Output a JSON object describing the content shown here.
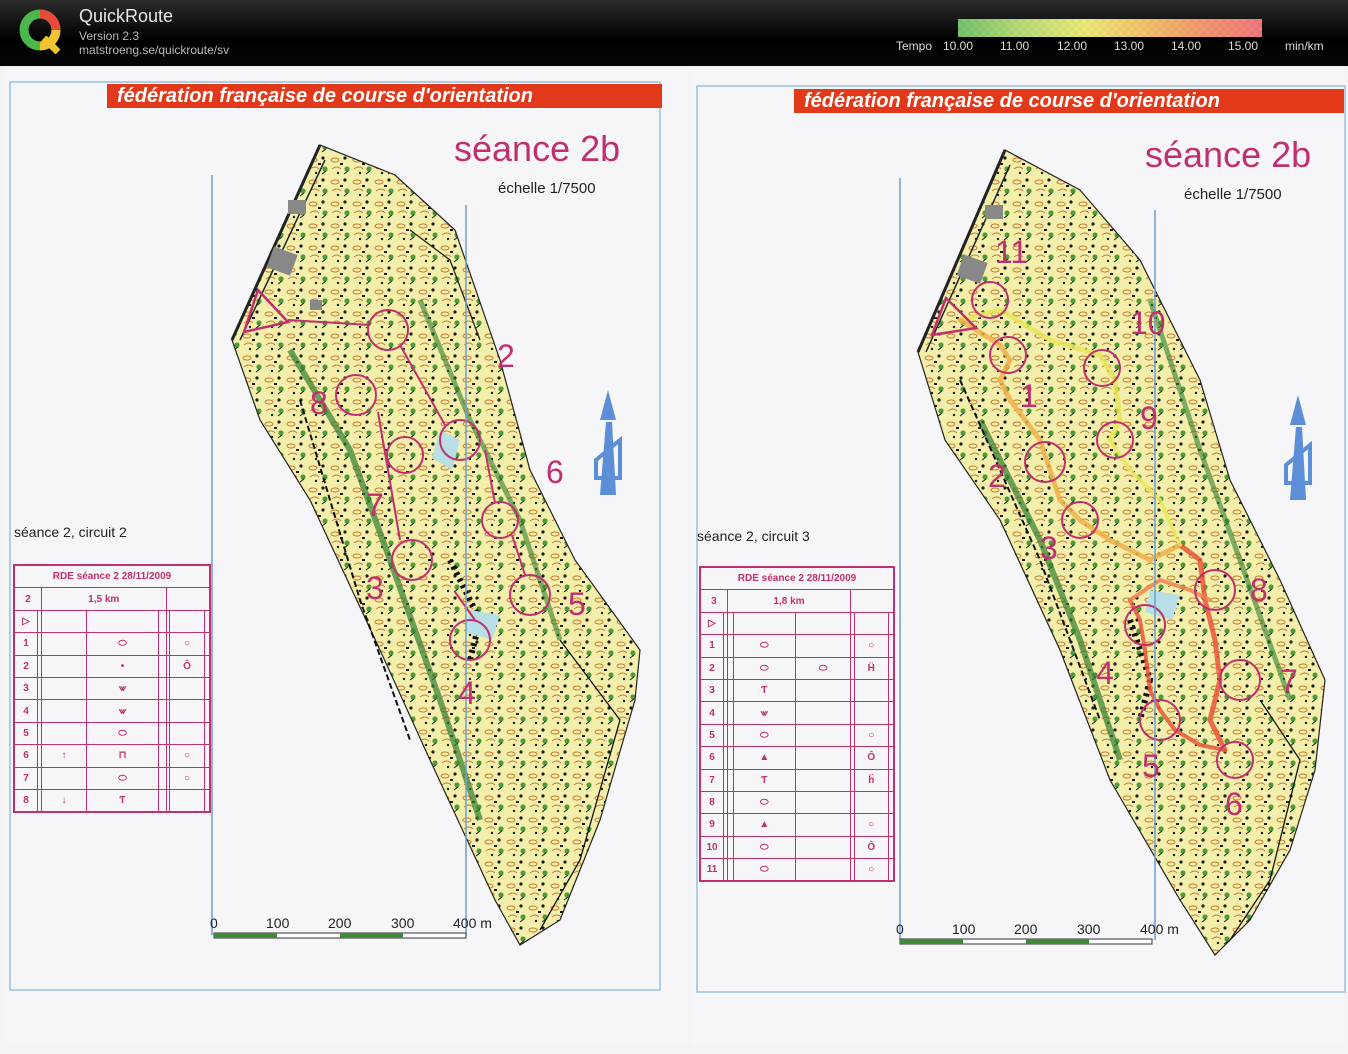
{
  "app": {
    "name": "QuickRoute",
    "version": "Version 2.3",
    "url": "matstroeng.se/quickroute/sv"
  },
  "tempo": {
    "label": "Tempo",
    "ticks": [
      "10.00",
      "11.00",
      "12.00",
      "13.00",
      "14.00",
      "15.00"
    ],
    "unit": "min/km",
    "colors": [
      "#55b54a",
      "#a8d35a",
      "#e9e65a",
      "#f2b44a",
      "#f0834e",
      "#ee5a60"
    ]
  },
  "colors": {
    "banner": "#e2391b",
    "course": "#c0306e",
    "map_bg": "#f3efaa",
    "route_fast": "#e8e45a",
    "route_slow": "#e8553a"
  },
  "left": {
    "banner": "fédération française de course d'orientation",
    "title": "séance 2b",
    "scale": "échelle 1/7500",
    "circuit": "séance 2, circuit 2",
    "table": {
      "header": "RDE séance 2 28/11/2009",
      "course": "2",
      "length": "1,5 km",
      "rows": [
        [
          "▷",
          "",
          "",
          "",
          "",
          "",
          "",
          ""
        ],
        [
          "1",
          "",
          "",
          "⬭",
          "",
          "",
          "○",
          ""
        ],
        [
          "2",
          "",
          "",
          "•",
          "",
          "",
          "Ô",
          ""
        ],
        [
          "3",
          "",
          "",
          "⩖",
          "",
          "",
          "",
          ""
        ],
        [
          "4",
          "",
          "",
          "⩖",
          "",
          "",
          "",
          ""
        ],
        [
          "5",
          "",
          "",
          "⬭",
          "",
          "",
          "",
          ""
        ],
        [
          "6",
          "",
          "↑",
          "⊓",
          "",
          "",
          "○",
          ""
        ],
        [
          "7",
          "",
          "",
          "⬭",
          "",
          "",
          "○",
          ""
        ],
        [
          "8",
          "",
          "↓",
          "Ƭ",
          "",
          "",
          "",
          ""
        ]
      ]
    },
    "controls": [
      "2",
      "8",
      "6",
      "7",
      "3",
      "5",
      "4"
    ],
    "scale_labels": [
      "0",
      "100",
      "200",
      "300",
      "400 m"
    ]
  },
  "right": {
    "banner": "fédération française de course d'orientation",
    "title": "séance 2b",
    "scale": "échelle 1/7500",
    "circuit": "séance 2, circuit 3",
    "table": {
      "header": "RDE séance 2 28/11/2009",
      "course": "3",
      "length": "1,8 km",
      "rows": [
        [
          "▷",
          "",
          "",
          "",
          "",
          "",
          "",
          ""
        ],
        [
          "1",
          "",
          "",
          "⬭",
          "",
          "",
          "○",
          ""
        ],
        [
          "2",
          "",
          "",
          "⬭",
          "⬭",
          "",
          "Ḧ",
          ""
        ],
        [
          "3",
          "",
          "",
          "Ƭ",
          "",
          "",
          "",
          ""
        ],
        [
          "4",
          "",
          "",
          "⩖",
          "",
          "",
          "",
          ""
        ],
        [
          "5",
          "",
          "",
          "⬭",
          "",
          "",
          "○",
          ""
        ],
        [
          "6",
          "",
          "",
          "▲",
          "",
          "",
          "Ô",
          ""
        ],
        [
          "7",
          "",
          "",
          "Ƭ",
          "",
          "",
          "ḧ",
          ""
        ],
        [
          "8",
          "",
          "",
          "⬭",
          "",
          "",
          "",
          ""
        ],
        [
          "9",
          "",
          "",
          "▲",
          "",
          "",
          "○",
          ""
        ],
        [
          "10",
          "",
          "",
          "⬭",
          "",
          "",
          "Ô",
          ""
        ],
        [
          "11",
          "",
          "",
          "⬭",
          "",
          "",
          "○",
          ""
        ]
      ]
    },
    "controls": [
      "11",
      "10",
      "1",
      "9",
      "2",
      "3",
      "8",
      "4",
      "7",
      "5",
      "6"
    ],
    "scale_labels": [
      "0",
      "100",
      "200",
      "300",
      "400 m"
    ]
  }
}
